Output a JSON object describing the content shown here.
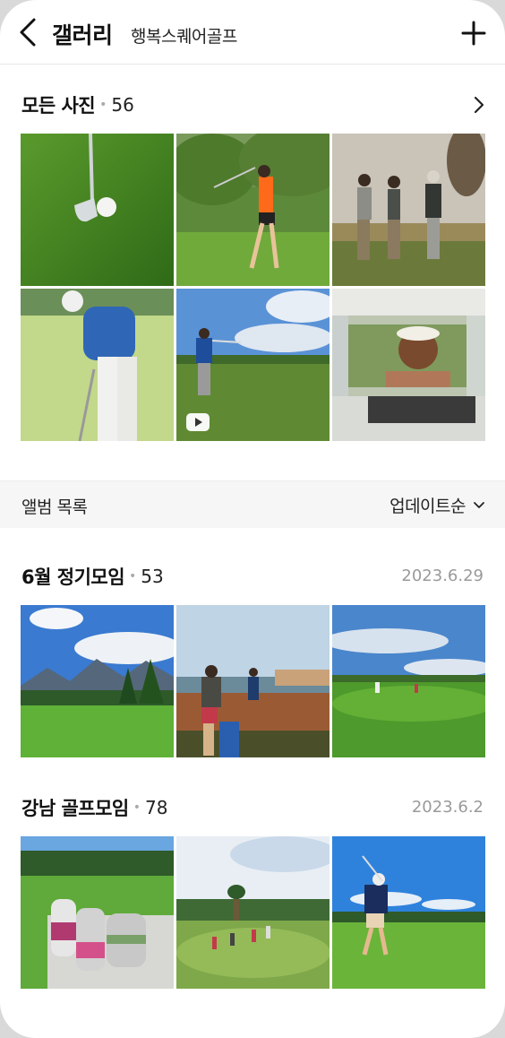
{
  "header": {
    "title": "갤러리",
    "subtitle": "행복스퀘어골프",
    "back_icon": "chevron-left-icon",
    "add_icon": "plus-icon"
  },
  "all_photos": {
    "title": "모든 사진",
    "count": "56",
    "photos": [
      {
        "name": "golf-club-ball"
      },
      {
        "name": "woman-swinging"
      },
      {
        "name": "men-group-sunset"
      },
      {
        "name": "woman-putting"
      },
      {
        "name": "man-swinging-video",
        "is_video": true
      },
      {
        "name": "woman-golf-cart"
      }
    ]
  },
  "album_list": {
    "label": "앨범 목록",
    "sort": "업데이트순"
  },
  "albums": [
    {
      "title": "6월 정기모임",
      "count": "53",
      "date": "2023.6.29"
    },
    {
      "title": "강남 골프모임",
      "count": "78",
      "date": "2023.6.2"
    }
  ],
  "colors": {
    "text": "#111111",
    "muted": "#9a9a9a",
    "bar_bg": "#f6f6f6"
  }
}
